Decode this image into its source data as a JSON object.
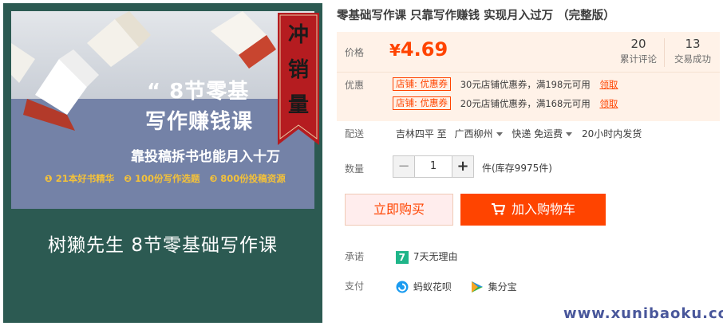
{
  "image": {
    "headline_line1": "“ 8节零基",
    "headline_line2": "写作赚钱课",
    "subline": "靠投稿拆书也能月入十万",
    "bullet_1": "❶ 21本好书精华",
    "bullet_2": "❷ 100份写作选题",
    "bullet_3": "❸ 800份投稿资源",
    "ribbon_text": [
      "冲",
      "销",
      "量"
    ],
    "lower_title": "树獭先生  8节零基础写作课"
  },
  "product": {
    "title": "零基础写作课 只靠写作赚钱 实现月入过万 （完整版）"
  },
  "price": {
    "label": "价格",
    "currency": "¥",
    "amount": "4.69",
    "reviews_count": "20",
    "reviews_label": "累计评论",
    "sales_count": "13",
    "sales_label": "交易成功"
  },
  "promo": {
    "label": "优惠",
    "coupons": [
      {
        "tag": "店铺: 优惠券",
        "desc": "30元店铺优惠券，满198元可用",
        "action": "领取"
      },
      {
        "tag": "店铺: 优惠券",
        "desc": "20元店铺优惠券，满168元可用",
        "action": "领取"
      }
    ]
  },
  "shipping": {
    "label": "配送",
    "from": "吉林四平 至",
    "to": "广西柳州",
    "method": "快递 免运费",
    "dispatch": "20小时内发货"
  },
  "quantity": {
    "label": "数量",
    "minus": "−",
    "value": "1",
    "plus": "+",
    "stock_text": "件(库存9975件)"
  },
  "actions": {
    "buy_now": "立即购买",
    "add_to_cart": "加入购物车"
  },
  "promise": {
    "label": "承诺",
    "badge": "7",
    "text": "7天无理由"
  },
  "payment": {
    "label": "支付",
    "methods": [
      "蚂蚁花呗",
      "集分宝"
    ]
  },
  "watermark": "www.xunibaoku.com",
  "colors": {
    "accent": "#ff4400",
    "price_box_bg": "#fff2e8",
    "image_bg": "#2c5a52",
    "promise_badge": "#1fb589"
  }
}
